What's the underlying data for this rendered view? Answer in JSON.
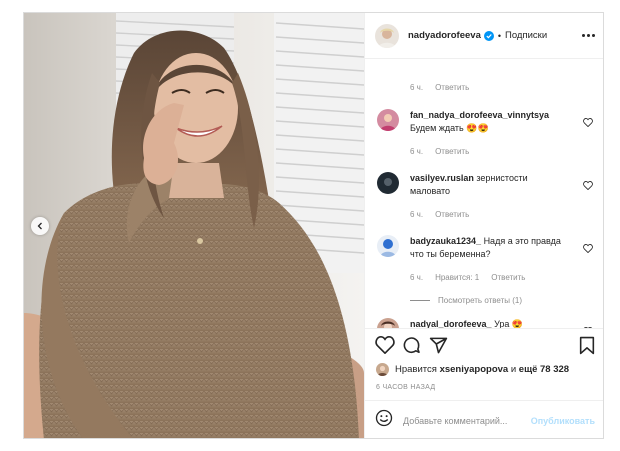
{
  "post": {
    "username": "nadyadorofeeva",
    "follow_label": "Подписки",
    "separator": "•"
  },
  "comments": {
    "first_meta": {
      "time": "6 ч.",
      "reply": "Ответить"
    },
    "items": [
      {
        "user": "fan_nadya_dorofeeva_vinnytsya",
        "text": "Будем ждать 😍😍",
        "time": "6 ч.",
        "likes": "",
        "reply": "Ответить"
      },
      {
        "user": "vasilyev.ruslan",
        "text": "зернистости маловато",
        "time": "6 ч.",
        "likes": "",
        "reply": "Ответить"
      },
      {
        "user": "badyzauka1234_",
        "text": "Надя а это правда что ты беременна?",
        "time": "6 ч.",
        "likes": "Нравится: 1",
        "reply": "Ответить"
      },
      {
        "user": "nadyal_dorofeeva_",
        "text": "Ура 😍",
        "time": "",
        "likes": "",
        "reply": ""
      }
    ],
    "view_replies": "Посмотреть ответы (1)"
  },
  "likes": {
    "prefix": "Нравится",
    "user": "xseniyapopova",
    "middle": "и",
    "count": "ещё 78 328"
  },
  "time_ago": "6 ЧАСОВ НАЗАД",
  "add_comment": {
    "placeholder": "Добавьте комментарий...",
    "publish_label": "Опубликовать"
  },
  "icons": {
    "verified": "verified-badge-icon",
    "heart": "heart-icon",
    "comment": "comment-icon",
    "share": "share-icon",
    "bookmark": "bookmark-icon",
    "emoji": "emoji-icon",
    "more": "more-options-icon",
    "prev": "chevron-left-icon"
  },
  "colors": {
    "accent": "#0095f6",
    "publish_disabled": "#b2dffc",
    "muted_text": "#8e8e8e",
    "border": "#dbdbdb"
  }
}
